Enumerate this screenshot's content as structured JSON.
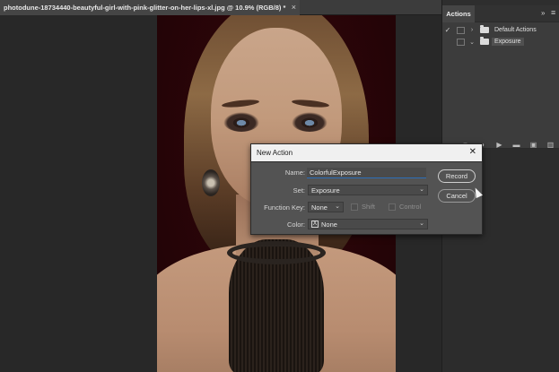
{
  "document": {
    "tab_title": "photodune-18734440-beautyful-girl-with-pink-glitter-on-her-lips-xl.jpg @ 10.9% (RGB/8) *",
    "tab_close": "×"
  },
  "actions_panel": {
    "tab_label": "Actions",
    "collapse_glyph": "»",
    "menu_glyph": "≡",
    "sets": [
      {
        "checked": "✓",
        "expander": "›",
        "label": "Default Actions"
      },
      {
        "checked": "",
        "expander": "⌄",
        "label": "Exposure"
      }
    ],
    "footer_icons": [
      "stop-icon",
      "record-icon",
      "play-icon",
      "new-set-icon",
      "new-action-icon",
      "delete-icon"
    ]
  },
  "new_action_dialog": {
    "title": "New Action",
    "close_glyph": "✕",
    "name_label": "Name:",
    "name_value": "ColorfulExposure",
    "set_label": "Set:",
    "set_value": "Exposure",
    "function_key_label": "Function Key:",
    "function_key_value": "None",
    "shift_label": "Shift",
    "control_label": "Control",
    "color_label": "Color:",
    "color_value": "None",
    "color_swatch_glyph": "X",
    "record_button": "Record",
    "cancel_button": "Cancel"
  }
}
